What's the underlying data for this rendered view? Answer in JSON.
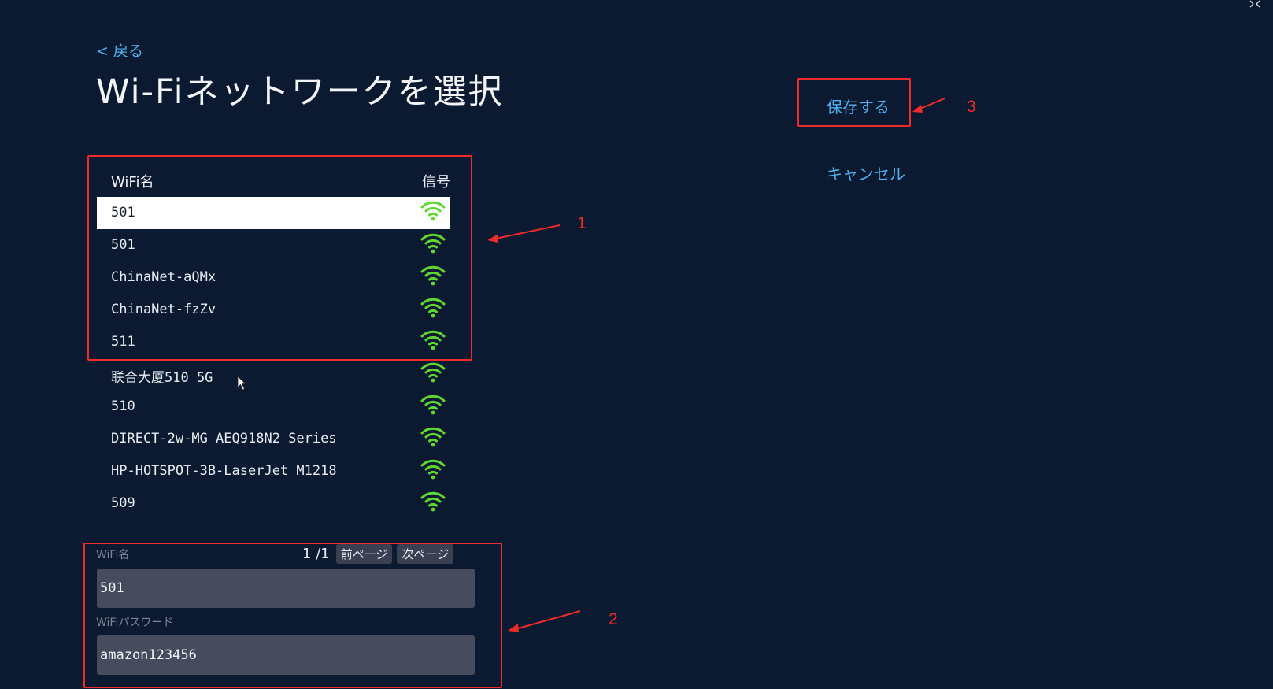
{
  "back_link": "< 戻る",
  "page_title": "Wi-Fiネットワークを選択",
  "list": {
    "header_name": "WiFi名",
    "header_signal": "信号",
    "networks": [
      {
        "ssid": "501",
        "signal": "full",
        "selected": true
      },
      {
        "ssid": "501",
        "signal": "full",
        "selected": false
      },
      {
        "ssid": "ChinaNet-aQMx",
        "signal": "full",
        "selected": false
      },
      {
        "ssid": "ChinaNet-fzZv",
        "signal": "full",
        "selected": false
      },
      {
        "ssid": "511",
        "signal": "full",
        "selected": false
      },
      {
        "ssid": "联合大厦510 5G",
        "signal": "full",
        "selected": false
      },
      {
        "ssid": "510",
        "signal": "full",
        "selected": false
      },
      {
        "ssid": "DIRECT-2w-MG AEQ918N2 Series",
        "signal": "full",
        "selected": false
      },
      {
        "ssid": "HP-HOTSPOT-3B-LaserJet M1218",
        "signal": "full",
        "selected": false
      },
      {
        "ssid": "509",
        "signal": "full",
        "selected": false
      }
    ]
  },
  "pager": {
    "page_indicator": "1 /1",
    "prev_label": "前ページ",
    "next_label": "次ページ"
  },
  "form": {
    "ssid_label": "WiFi名",
    "ssid_value": "501",
    "password_label": "WiFiパスワード",
    "password_value": "amazon123456"
  },
  "actions": {
    "save_label": "保存する",
    "cancel_label": "キャンセル"
  },
  "annotations": {
    "n1": "1",
    "n2": "2",
    "n3": "3"
  },
  "colors": {
    "background": "#0b1a30",
    "accent": "#4fb0ee",
    "signal": "#5fd832",
    "annotation": "#ee2b2b",
    "input_bg": "#474b5e"
  }
}
